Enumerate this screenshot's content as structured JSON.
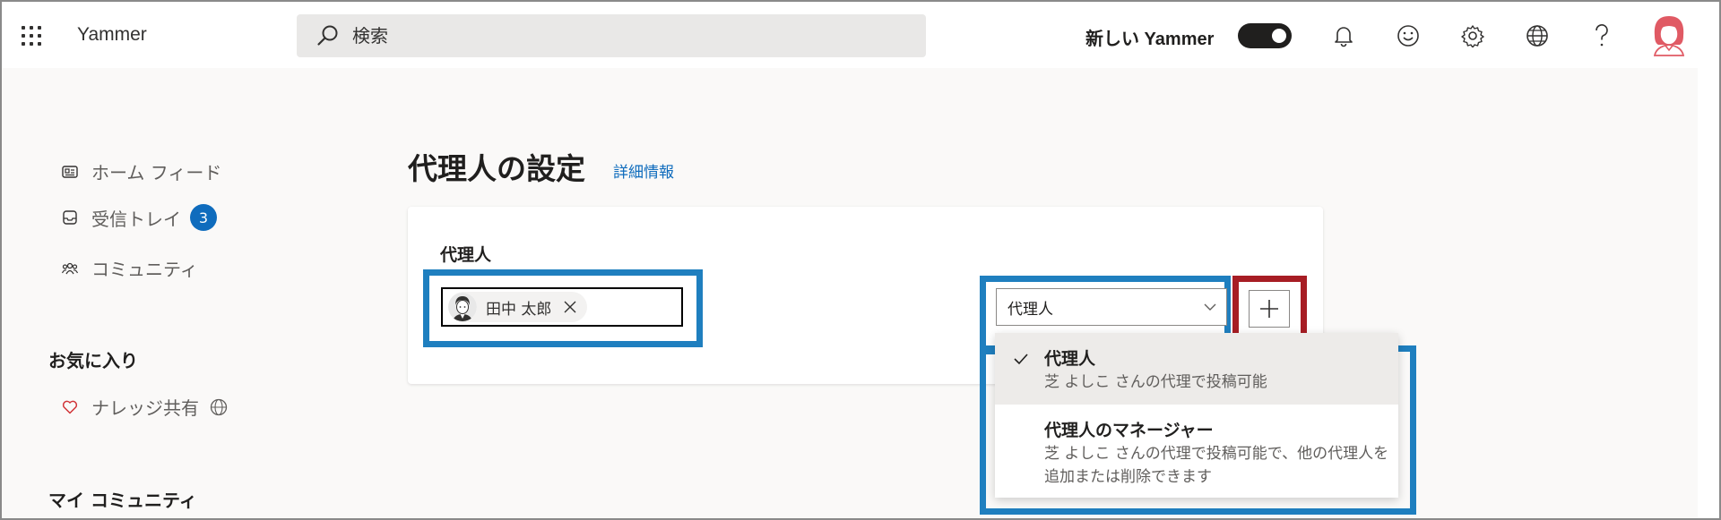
{
  "topbar": {
    "brand": "Yammer",
    "search_placeholder": "検索",
    "new_yammer_label": "新しい Yammer",
    "new_yammer_on": true
  },
  "nav": {
    "items": [
      {
        "label": "ホーム フィード",
        "icon": "news-icon"
      },
      {
        "label": "受信トレイ",
        "icon": "inbox-icon",
        "badge": "3"
      },
      {
        "label": "コミュニティ",
        "icon": "people-icon"
      }
    ],
    "favorites_heading": "お気に入り",
    "favorites": [
      {
        "label": "ナレッジ共有",
        "icon": "heart-icon",
        "trail_icon": "globe-icon"
      }
    ],
    "my_communities_heading": "マイ コミュニティ"
  },
  "main": {
    "title": "代理人の設定",
    "details_link": "詳細情報",
    "field_label": "代理人",
    "selected_person": "田中 太郎",
    "role_select_value": "代理人",
    "dropdown": [
      {
        "title": "代理人",
        "desc": "芝 よしこ さんの代理で投稿可能",
        "selected": true
      },
      {
        "title": "代理人のマネージャー",
        "desc": "芝 よしこ さんの代理で投稿可能で、他の代理人を追加または削除できます",
        "selected": false
      }
    ]
  },
  "colors": {
    "highlight_blue": "#1f7fbf",
    "highlight_red": "#a71d24",
    "accent": "#0f6cbd"
  }
}
